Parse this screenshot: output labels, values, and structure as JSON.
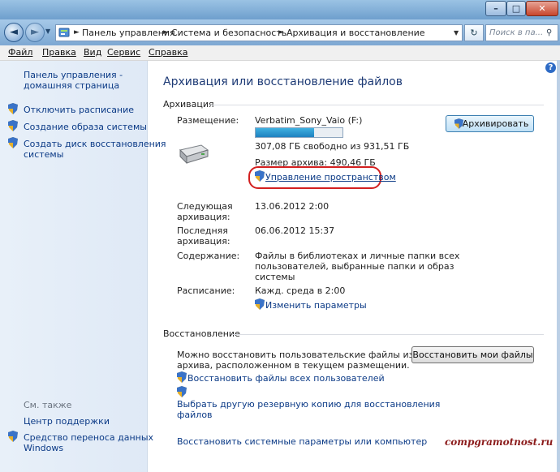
{
  "window": {
    "minimize_glyph": "–",
    "maximize_glyph": "□",
    "close_glyph": "✕"
  },
  "address": {
    "path": [
      "Панель управления",
      "Система и безопасность",
      "Архивация и восстановление"
    ],
    "separator": "►",
    "search_placeholder": "Поиск в па...",
    "refresh_glyph": "↻"
  },
  "menu": {
    "file": "Файл",
    "edit": "Правка",
    "view": "Вид",
    "service": "Сервис",
    "help": "Справка"
  },
  "sidebar": {
    "home_line1": "Панель управления -",
    "home_line2": "домашняя страница",
    "items": [
      {
        "label": "Отключить расписание"
      },
      {
        "label": "Создание образа системы"
      },
      {
        "label_line1": "Создать диск восстановления",
        "label_line2": "системы"
      }
    ],
    "see_also": "См. также",
    "support": "Центр поддержки",
    "transfer_line1": "Средство переноса данных",
    "transfer_line2": "Windows"
  },
  "main": {
    "title": "Архивация или восстановление файлов",
    "backup_section": "Архивация",
    "location_label": "Размещение:",
    "location_value": "Verbatim_Sony_Vaio (F:)",
    "disk_usage_fraction": 0.67,
    "free_space": "307,08 ГБ свободно из 931,51 ГБ",
    "backup_size": "Размер архива: 490,46 ГБ",
    "manage_space": "Управление пространством",
    "backup_button": "Архивировать",
    "next_label_line1": "Следующая",
    "next_label_line2": "архивация:",
    "next_value": "13.06.2012 2:00",
    "last_label_line1": "Последняя",
    "last_label_line2": "архивация:",
    "last_value": "06.06.2012 15:37",
    "contents_label": "Содержание:",
    "contents_line1": "Файлы в библиотеках и личные папки всех",
    "contents_line2": "пользователей, выбранные папки и образ",
    "contents_line3": "системы",
    "schedule_label": "Расписание:",
    "schedule_value": "Кажд. среда в 2:00",
    "change_settings": "Изменить параметры",
    "restore_section": "Восстановление",
    "restore_text_line1": "Можно восстановить пользовательские файлы из",
    "restore_text_line2": "архива, расположенном в текущем размещении.",
    "restore_button": "Восстановить мои файлы",
    "restore_all_users": "Восстановить файлы всех пользователей",
    "choose_other_line1": "Выбрать другую резервную копию для восстановления",
    "choose_other_line2": "файлов",
    "restore_system": "Восстановить системные параметры или компьютер"
  },
  "watermark": "compgramotnost.ru",
  "help_glyph": "?"
}
